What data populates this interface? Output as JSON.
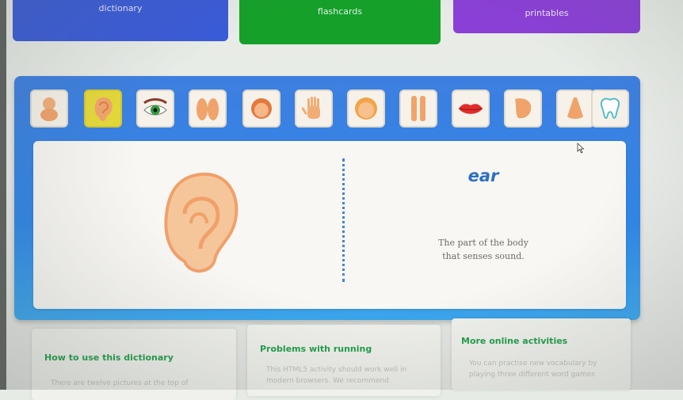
{
  "nav": {
    "dictionary": "dictionary",
    "flashcards": "flashcards",
    "printables": "printables"
  },
  "thumbnails": [
    {
      "name": "baby",
      "icon": "baby-icon"
    },
    {
      "name": "ear",
      "icon": "ear-icon",
      "selected": true
    },
    {
      "name": "eye",
      "icon": "eye-icon"
    },
    {
      "name": "feet",
      "icon": "feet-icon"
    },
    {
      "name": "girl-face",
      "icon": "face-icon"
    },
    {
      "name": "hand",
      "icon": "hand-icon"
    },
    {
      "name": "head",
      "icon": "head-icon"
    },
    {
      "name": "legs",
      "icon": "legs-icon"
    },
    {
      "name": "lips",
      "icon": "lips-icon"
    },
    {
      "name": "neck",
      "icon": "neck-icon"
    },
    {
      "name": "nose",
      "icon": "nose-icon"
    },
    {
      "name": "tooth",
      "icon": "tooth-icon"
    }
  ],
  "card": {
    "word": "ear",
    "definition_line1": "The part of the body",
    "definition_line2": "that senses sound."
  },
  "info": {
    "how_title": "How to use this dictionary",
    "how_text": "There are twelve pictures at the top of",
    "problems_title": "Problems with running",
    "problems_text1": "This HTML5 activity should work well in",
    "problems_text2": "modern browsers. We recommend",
    "more_title": "More online activities",
    "more_text1": "You can practise new vocabulary by",
    "more_text2": "playing three different word games"
  },
  "colors": {
    "panel_blue": "#2f86e8",
    "selected_yellow": "#e5d93a",
    "word_blue": "#2d6ec4",
    "heading_green": "#1f9e4a"
  }
}
